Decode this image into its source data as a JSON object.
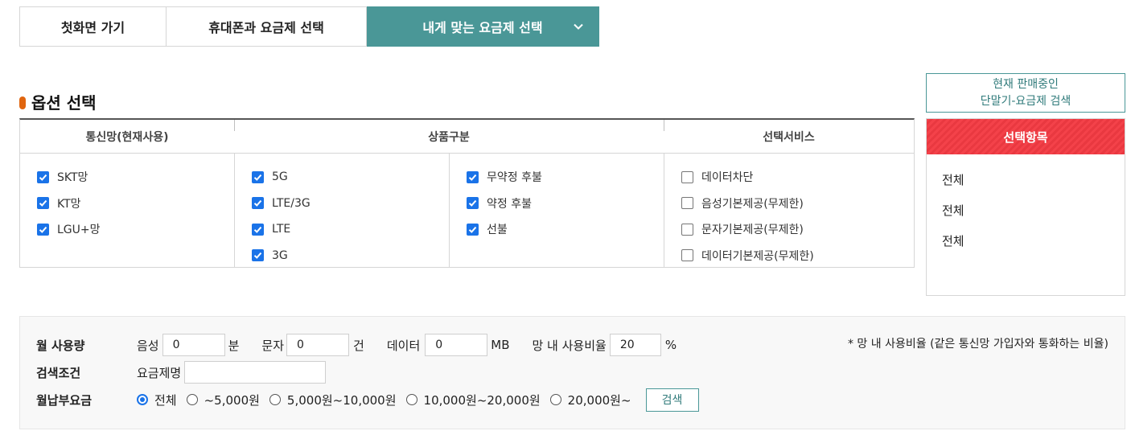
{
  "tabs": [
    {
      "label": "첫화면 가기",
      "active": false
    },
    {
      "label": "휴대폰과 요금제 선택",
      "active": false
    },
    {
      "label": "내게 맞는 요금제 선택",
      "active": true
    }
  ],
  "section_title": "옵션 선택",
  "options": {
    "headers": [
      "통신망(현재사용)",
      "상품구분",
      "선택서비스"
    ],
    "network": [
      {
        "label": "SKT망",
        "checked": true
      },
      {
        "label": "KT망",
        "checked": true
      },
      {
        "label": "LGU+망",
        "checked": true
      }
    ],
    "product_type": [
      {
        "label": "5G",
        "checked": true
      },
      {
        "label": "LTE/3G",
        "checked": true
      },
      {
        "label": "LTE",
        "checked": true
      },
      {
        "label": "3G",
        "checked": true
      }
    ],
    "contract_type": [
      {
        "label": "무약정 후불",
        "checked": true
      },
      {
        "label": "약정 후불",
        "checked": true
      },
      {
        "label": "선불",
        "checked": true
      }
    ],
    "services": [
      {
        "label": "데이터차단",
        "checked": false
      },
      {
        "label": "음성기본제공(무제한)",
        "checked": false
      },
      {
        "label": "문자기본제공(무제한)",
        "checked": false
      },
      {
        "label": "데이터기본제공(무제한)",
        "checked": false
      }
    ]
  },
  "right_panel": {
    "search_button_line1": "현재 판매중인",
    "search_button_line2": "단말기-요금제 검색",
    "selected_header": "선택항목",
    "selected_items": [
      "전체",
      "전체",
      "전체"
    ]
  },
  "form": {
    "usage_label": "월 사용량",
    "voice_label": "음성",
    "voice_value": "0",
    "voice_unit": "분",
    "sms_label": "문자",
    "sms_value": "0",
    "sms_unit": "건",
    "data_label": "데이터",
    "data_value": "0",
    "data_unit": "MB",
    "ratio_label": "망 내 사용비율",
    "ratio_value": "20",
    "ratio_unit": "%",
    "note": "* 망 내 사용비율 (같은 통신망 가입자와 통화하는 비율)",
    "search_cond_label": "검색조건",
    "plan_name_label": "요금제명",
    "plan_name_value": "",
    "fee_label": "월납부요금",
    "fee_options": [
      {
        "label": "전체",
        "selected": true
      },
      {
        "label": "~5,000원",
        "selected": false
      },
      {
        "label": "5,000원~10,000원",
        "selected": false
      },
      {
        "label": "10,000원~20,000원",
        "selected": false
      },
      {
        "label": "20,000원~",
        "selected": false
      }
    ],
    "search_label": "검색"
  },
  "colors": {
    "teal": "#4a9797",
    "accent_red": "#f4424a",
    "orange_bullet": "#e0650f",
    "checkbox_blue": "#1a73e8"
  }
}
